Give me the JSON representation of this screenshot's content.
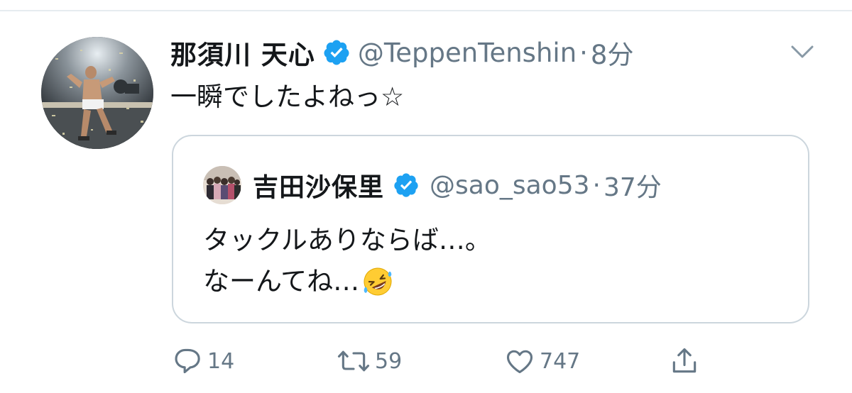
{
  "tweet": {
    "author_name": "那須川 天心",
    "handle": "@TeppenTenshin",
    "separator": "·",
    "time": "8分",
    "text": "一瞬でしたよねっ☆"
  },
  "quoted_tweet": {
    "author_name": "吉田沙保里",
    "handle": "@sao_sao53",
    "separator": "·",
    "time": "37分",
    "text_line1": "タックルありならば…。",
    "text_line2": "なーんてね…",
    "emoji": "rolling-on-the-floor-laughing-emoji"
  },
  "actions": {
    "reply_count": "14",
    "retweet_count": "59",
    "like_count": "747"
  },
  "colors": {
    "text": "#14171a",
    "secondary": "#657786",
    "verified": "#1da1f2",
    "border": "#ccd6dd",
    "icon": "#657786"
  },
  "icons": [
    "reply-icon",
    "retweet-icon",
    "like-icon",
    "share-icon",
    "verified-badge-icon",
    "caret-down-icon"
  ]
}
